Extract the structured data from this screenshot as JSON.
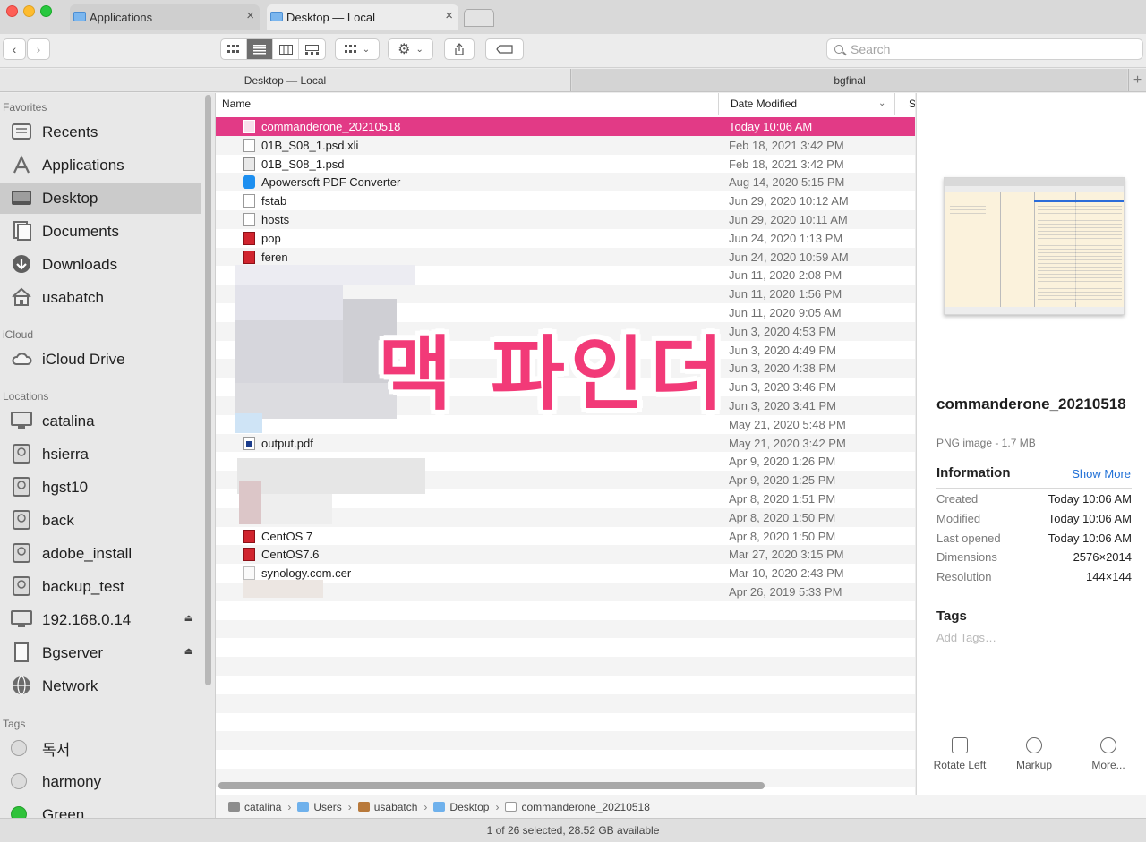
{
  "window": {
    "tabs": [
      {
        "label": "Applications"
      },
      {
        "label": "Desktop — Local"
      }
    ]
  },
  "toolbar": {
    "search_placeholder": "Search"
  },
  "panes": [
    {
      "label": "Desktop — Local"
    },
    {
      "label": "bgfinal"
    }
  ],
  "sidebar": {
    "favorites_label": "Favorites",
    "favorites": [
      {
        "label": "Recents",
        "icon": "clock-icon"
      },
      {
        "label": "Applications",
        "icon": "applications-icon"
      },
      {
        "label": "Desktop",
        "icon": "desktop-icon"
      },
      {
        "label": "Documents",
        "icon": "documents-icon"
      },
      {
        "label": "Downloads",
        "icon": "downloads-icon"
      },
      {
        "label": "usabatch",
        "icon": "home-icon"
      }
    ],
    "icloud_label": "iCloud",
    "icloud": [
      {
        "label": "iCloud Drive",
        "icon": "cloud-icon"
      }
    ],
    "locations_label": "Locations",
    "locations": [
      {
        "label": "catalina",
        "icon": "computer-icon"
      },
      {
        "label": "hsierra",
        "icon": "drive-icon"
      },
      {
        "label": "hgst10",
        "icon": "drive-icon"
      },
      {
        "label": "back",
        "icon": "drive-icon"
      },
      {
        "label": "adobe_install",
        "icon": "drive-icon"
      },
      {
        "label": "backup_test",
        "icon": "drive-icon"
      },
      {
        "label": "192.168.0.14",
        "icon": "server-icon"
      },
      {
        "label": "Bgserver",
        "icon": "server-doc-icon"
      },
      {
        "label": "Network",
        "icon": "network-globe-icon"
      }
    ],
    "tags_label": "Tags",
    "tags": [
      {
        "label": "독서",
        "color": "#dcdcdc"
      },
      {
        "label": "harmony",
        "color": "#dcdcdc"
      },
      {
        "label": "Green",
        "color": "#2fc23a"
      }
    ]
  },
  "list": {
    "columns": {
      "name": "Name",
      "date": "Date Modified",
      "size": "S"
    },
    "rows": [
      {
        "name": "commanderone_20210518",
        "date": "Today 10:06 AM"
      },
      {
        "name": "01B_S08_1.psd.xli",
        "date": "Feb 18, 2021 3:42 PM"
      },
      {
        "name": "01B_S08_1.psd",
        "date": "Feb 18, 2021 3:42 PM"
      },
      {
        "name": "Apowersoft PDF Converter",
        "date": "Aug 14, 2020 5:15 PM"
      },
      {
        "name": "fstab",
        "date": "Jun 29, 2020 10:12 AM"
      },
      {
        "name": "hosts",
        "date": "Jun 29, 2020 10:11 AM"
      },
      {
        "name": "pop",
        "date": "Jun 24, 2020 1:13 PM"
      },
      {
        "name": "feren",
        "date": "Jun 24, 2020 10:59 AM"
      },
      {
        "name": "",
        "date": "Jun 11, 2020 2:08 PM"
      },
      {
        "name": "",
        "date": "Jun 11, 2020 1:56 PM"
      },
      {
        "name": "",
        "date": "Jun 11, 2020 9:05 AM"
      },
      {
        "name": "",
        "date": "Jun 3, 2020 4:53 PM"
      },
      {
        "name": "",
        "date": "Jun 3, 2020 4:49 PM"
      },
      {
        "name": "",
        "date": "Jun 3, 2020 4:38 PM"
      },
      {
        "name": "",
        "date": "Jun 3, 2020 3:46 PM"
      },
      {
        "name": "",
        "date": "Jun 3, 2020 3:41 PM"
      },
      {
        "name": "",
        "date": "May 21, 2020 5:48 PM"
      },
      {
        "name": "output.pdf",
        "date": "May 21, 2020 3:42 PM"
      },
      {
        "name": "",
        "date": "Apr 9, 2020 1:26 PM"
      },
      {
        "name": "",
        "date": "Apr 9, 2020 1:25 PM"
      },
      {
        "name": "",
        "date": "Apr 8, 2020 1:51 PM"
      },
      {
        "name": "",
        "date": "Apr 8, 2020 1:50 PM"
      },
      {
        "name": "CentOS 7",
        "date": "Apr 8, 2020 1:50 PM"
      },
      {
        "name": "CentOS7.6",
        "date": "Mar 27, 2020 3:15 PM"
      },
      {
        "name": "synology.com.cer",
        "date": "Mar 10, 2020 2:43 PM"
      },
      {
        "name": "",
        "date": "Apr 26, 2019 5:33 PM"
      }
    ],
    "overlay_text": "맥 파인더"
  },
  "pathbar": {
    "segments": [
      "catalina",
      "Users",
      "usabatch",
      "Desktop",
      "commanderone_20210518"
    ]
  },
  "status": {
    "text": "1 of 26 selected, 28.52 GB available"
  },
  "preview": {
    "title": "commanderone_20210518",
    "kind": "PNG image - 1.7 MB",
    "info_header": "Information",
    "show_more": "Show More",
    "info": [
      {
        "key": "Created",
        "value": "Today 10:06 AM"
      },
      {
        "key": "Modified",
        "value": "Today 10:06 AM"
      },
      {
        "key": "Last opened",
        "value": "Today 10:06 AM"
      },
      {
        "key": "Dimensions",
        "value": "2576×2014"
      },
      {
        "key": "Resolution",
        "value": "144×144"
      }
    ],
    "tags_header": "Tags",
    "tags_placeholder": "Add Tags…",
    "actions": [
      {
        "label": "Rotate Left",
        "icon": "rotate-left-icon"
      },
      {
        "label": "Markup",
        "icon": "markup-pen-icon"
      },
      {
        "label": "More...",
        "icon": "more-ellipsis-icon"
      }
    ]
  },
  "colors": {
    "selection": "#e23a86",
    "overlay": "#f23a78",
    "link": "#1f6fd6"
  }
}
